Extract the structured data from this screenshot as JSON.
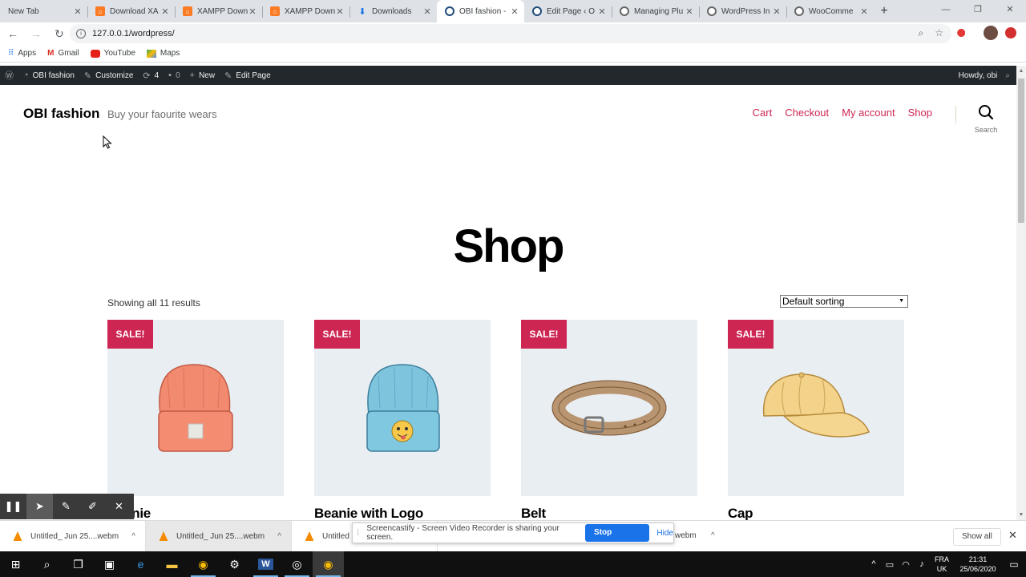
{
  "browser": {
    "tabs": [
      {
        "title": "New Tab",
        "favicon": "none"
      },
      {
        "title": "Download XA",
        "favicon": "xampp"
      },
      {
        "title": "XAMPP Down",
        "favicon": "xampp"
      },
      {
        "title": "XAMPP Down",
        "favicon": "xampp"
      },
      {
        "title": "Downloads",
        "favicon": "download"
      },
      {
        "title": "OBI fashion -",
        "favicon": "wordpress-blue",
        "active": true
      },
      {
        "title": "Edit Page ‹ O",
        "favicon": "wordpress-blue"
      },
      {
        "title": "Managing Plu",
        "favicon": "wordpress"
      },
      {
        "title": "WordPress In",
        "favicon": "wordpress"
      },
      {
        "title": "WooComme",
        "favicon": "wordpress"
      }
    ],
    "url": "127.0.0.1/wordpress/",
    "bookmarks": [
      "Apps",
      "Gmail",
      "YouTube",
      "Maps"
    ]
  },
  "wpbar": {
    "site_name": "OBI fashion",
    "customize": "Customize",
    "updates": "4",
    "comments": "0",
    "new": "New",
    "edit": "Edit Page",
    "howdy": "Howdy, obi"
  },
  "site": {
    "title": "OBI fashion",
    "tagline": "Buy your faourite wears",
    "menu": [
      "Cart",
      "Checkout",
      "My account",
      "Shop"
    ],
    "search_label": "Search",
    "accent": "#cd2653"
  },
  "shop": {
    "heading": "Shop",
    "result_count": "Showing all 11 results",
    "sorting": "Default sorting",
    "products": [
      {
        "name": "Beanie",
        "badge": "SALE!",
        "color": "#f28a70"
      },
      {
        "name": "Beanie with Logo",
        "badge": "SALE!",
        "color": "#7ec4dd"
      },
      {
        "name": "Belt",
        "badge": "SALE!",
        "color": "#c9a57f"
      },
      {
        "name": "Cap",
        "badge": "SALE!",
        "color": "#f3d28a"
      }
    ]
  },
  "shelf": {
    "downloads": [
      "Untitled_ Jun 25....webm",
      "Untitled_ Jun 25....webm",
      "Untitled",
      "webm"
    ],
    "show_all": "Show all"
  },
  "share_bar": {
    "message": "Screencastify - Screen Video Recorder is sharing your screen.",
    "stop": "Stop sharing",
    "hide": "Hide"
  },
  "taskbar": {
    "lang1": "FRA",
    "lang2": "UK",
    "time": "21:31",
    "date": "25/06/2020"
  }
}
